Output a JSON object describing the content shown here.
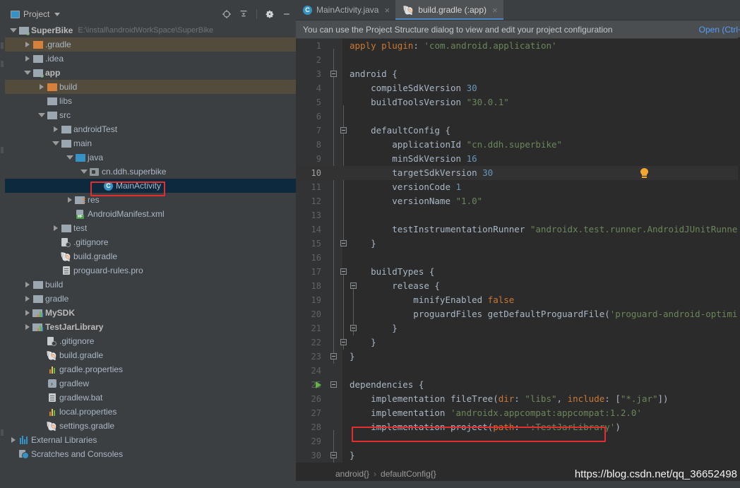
{
  "window": {
    "toolbar_chunks": [
      "run-config-chunk"
    ]
  },
  "sidebar": {
    "title": "Project",
    "icon": "project-icon",
    "tools": [
      "locate-target-icon",
      "collapse-all-icon",
      "gear-icon",
      "minimize-icon"
    ],
    "tree": [
      {
        "label": "SuperBike",
        "path": "E:\\install\\androidWorkSpace\\SuperBike",
        "icon": "module-folder-icon",
        "indent": 0,
        "arrow": "down",
        "bold": true,
        "state": "normal"
      },
      {
        "label": ".gradle",
        "icon": "folder-orange-icon",
        "indent": 1,
        "arrow": "right",
        "bold": false,
        "state": "excluded"
      },
      {
        "label": ".idea",
        "icon": "folder-gray-icon",
        "indent": 1,
        "arrow": "right",
        "bold": false,
        "state": "normal"
      },
      {
        "label": "app",
        "icon": "module-folder-icon",
        "indent": 1,
        "arrow": "down",
        "bold": true,
        "state": "normal"
      },
      {
        "label": "build",
        "icon": "folder-orange-icon",
        "indent": 2,
        "arrow": "right",
        "bold": false,
        "state": "excluded"
      },
      {
        "label": "libs",
        "icon": "folder-gray-icon",
        "indent": 2,
        "arrow": "none",
        "bold": false,
        "state": "normal"
      },
      {
        "label": "src",
        "icon": "folder-gray-icon",
        "indent": 2,
        "arrow": "down",
        "bold": false,
        "state": "normal"
      },
      {
        "label": "androidTest",
        "icon": "folder-gray-icon",
        "indent": 3,
        "arrow": "right",
        "bold": false,
        "state": "normal"
      },
      {
        "label": "main",
        "icon": "folder-gray-icon",
        "indent": 3,
        "arrow": "down",
        "bold": false,
        "state": "normal"
      },
      {
        "label": "java",
        "icon": "folder-blue-icon",
        "indent": 4,
        "arrow": "down",
        "bold": false,
        "state": "normal"
      },
      {
        "label": "cn.ddh.superbike",
        "icon": "package-icon",
        "indent": 5,
        "arrow": "down",
        "bold": false,
        "state": "normal"
      },
      {
        "label": "MainActivity",
        "icon": "java-class-icon",
        "indent": 6,
        "arrow": "none",
        "bold": false,
        "state": "selected"
      },
      {
        "label": "res",
        "icon": "res-folder-icon",
        "indent": 4,
        "arrow": "right",
        "bold": false,
        "state": "normal"
      },
      {
        "label": "AndroidManifest.xml",
        "icon": "manifest-icon",
        "indent": 4,
        "arrow": "none",
        "bold": false,
        "state": "normal"
      },
      {
        "label": "test",
        "icon": "folder-gray-icon",
        "indent": 3,
        "arrow": "right",
        "bold": false,
        "state": "normal"
      },
      {
        "label": ".gitignore",
        "icon": "gitignore-icon",
        "indent": 3,
        "arrow": "none",
        "bold": false,
        "state": "normal"
      },
      {
        "label": "build.gradle",
        "icon": "gradle-icon",
        "indent": 3,
        "arrow": "none",
        "bold": false,
        "state": "normal"
      },
      {
        "label": "proguard-rules.pro",
        "icon": "text-file-icon",
        "indent": 3,
        "arrow": "none",
        "bold": false,
        "state": "normal"
      },
      {
        "label": "build",
        "icon": "folder-gray-icon",
        "indent": 1,
        "arrow": "right",
        "bold": false,
        "state": "normal"
      },
      {
        "label": "gradle",
        "icon": "folder-gray-icon",
        "indent": 1,
        "arrow": "right",
        "bold": false,
        "state": "normal"
      },
      {
        "label": "MySDK",
        "icon": "library-module-icon",
        "indent": 1,
        "arrow": "right",
        "bold": true,
        "state": "normal"
      },
      {
        "label": "TestJarLibrary",
        "icon": "library-module-icon",
        "indent": 1,
        "arrow": "right",
        "bold": true,
        "state": "normal"
      },
      {
        "label": ".gitignore",
        "icon": "gitignore-icon",
        "indent": 2,
        "arrow": "none",
        "bold": false,
        "state": "normal"
      },
      {
        "label": "build.gradle",
        "icon": "gradle-icon",
        "indent": 2,
        "arrow": "none",
        "bold": false,
        "state": "normal"
      },
      {
        "label": "gradle.properties",
        "icon": "properties-icon",
        "indent": 2,
        "arrow": "none",
        "bold": false,
        "state": "normal"
      },
      {
        "label": "gradlew",
        "icon": "script-icon",
        "indent": 2,
        "arrow": "none",
        "bold": false,
        "state": "normal"
      },
      {
        "label": "gradlew.bat",
        "icon": "text-file-icon",
        "indent": 2,
        "arrow": "none",
        "bold": false,
        "state": "normal"
      },
      {
        "label": "local.properties",
        "icon": "properties-icon",
        "indent": 2,
        "arrow": "none",
        "bold": false,
        "state": "normal"
      },
      {
        "label": "settings.gradle",
        "icon": "gradle-icon",
        "indent": 2,
        "arrow": "none",
        "bold": false,
        "state": "normal"
      },
      {
        "label": "External Libraries",
        "icon": "external-libraries-icon",
        "indent": 0,
        "arrow": "right",
        "bold": false,
        "state": "normal"
      },
      {
        "label": "Scratches and Consoles",
        "icon": "scratches-icon",
        "indent": 0,
        "arrow": "none",
        "bold": false,
        "state": "normal"
      }
    ]
  },
  "editor": {
    "tabs": [
      {
        "label": "MainActivity.java",
        "icon": "java-class-icon",
        "active": false,
        "close": "×"
      },
      {
        "label": "build.gradle (:app)",
        "icon": "gradle-icon",
        "active": true,
        "close": "×"
      }
    ],
    "notification": {
      "message": "You can use the Project Structure dialog to view and edit your project configuration",
      "action": "Open (Ctrl+"
    },
    "breadcrumb": [
      "android{}",
      "defaultConfig{}"
    ],
    "breadcrumb_separator": "›",
    "watermark": "https://blog.csdn.net/qq_36652498",
    "cursor_line": 10,
    "lines": [
      {
        "n": 1,
        "text": "apply plugin: 'com.android.application'"
      },
      {
        "n": 2,
        "text": ""
      },
      {
        "n": 3,
        "text": "android {"
      },
      {
        "n": 4,
        "text": "    compileSdkVersion 30"
      },
      {
        "n": 5,
        "text": "    buildToolsVersion \"30.0.1\""
      },
      {
        "n": 6,
        "text": ""
      },
      {
        "n": 7,
        "text": "    defaultConfig {"
      },
      {
        "n": 8,
        "text": "        applicationId \"cn.ddh.superbike\""
      },
      {
        "n": 9,
        "text": "        minSdkVersion 16"
      },
      {
        "n": 10,
        "text": "        targetSdkVersion 30"
      },
      {
        "n": 11,
        "text": "        versionCode 1"
      },
      {
        "n": 12,
        "text": "        versionName \"1.0\""
      },
      {
        "n": 13,
        "text": ""
      },
      {
        "n": 14,
        "text": "        testInstrumentationRunner \"androidx.test.runner.AndroidJUnitRunner\""
      },
      {
        "n": 15,
        "text": "    }"
      },
      {
        "n": 16,
        "text": ""
      },
      {
        "n": 17,
        "text": "    buildTypes {"
      },
      {
        "n": 18,
        "text": "        release {"
      },
      {
        "n": 19,
        "text": "            minifyEnabled false"
      },
      {
        "n": 20,
        "text": "            proguardFiles getDefaultProguardFile('proguard-android-optimize.txt')"
      },
      {
        "n": 21,
        "text": "        }"
      },
      {
        "n": 22,
        "text": "    }"
      },
      {
        "n": 23,
        "text": "}"
      },
      {
        "n": 24,
        "text": ""
      },
      {
        "n": 25,
        "text": "dependencies {"
      },
      {
        "n": 26,
        "text": "    implementation fileTree(dir: \"libs\", include: [\"*.jar\"])"
      },
      {
        "n": 27,
        "text": "    implementation 'androidx.appcompat:appcompat:1.2.0'"
      },
      {
        "n": 28,
        "text": "    implementation project(path: ':TestJarLibrary')"
      },
      {
        "n": 29,
        "text": ""
      },
      {
        "n": 30,
        "text": "}"
      }
    ]
  },
  "annotations": [
    {
      "name": "mainactivity-highlight",
      "target": "MainActivity"
    },
    {
      "name": "dependency-line-highlight",
      "target": "implementation project(path: ':TestJarLibrary')"
    }
  ],
  "colors": {
    "accent": "#3592c4",
    "annotation": "#e32e2e",
    "selection": "#0d293e",
    "excluded": "#534c3d",
    "link": "#589df6",
    "string": "#6a8759",
    "keyword": "#cc7832",
    "number": "#6897bb",
    "run_green": "#62b543",
    "bulb_orange": "#f0a732"
  }
}
